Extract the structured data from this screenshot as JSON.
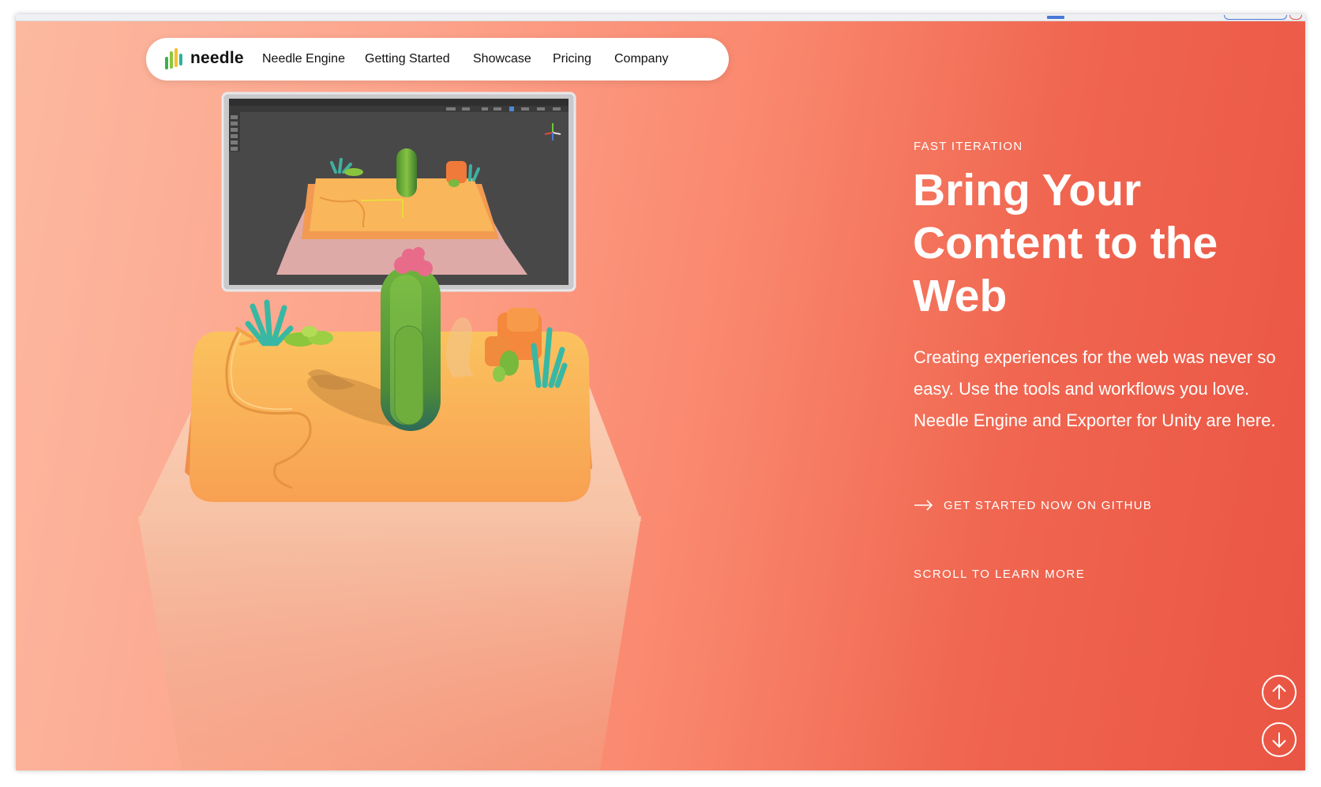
{
  "nav": {
    "logo_text": "needle",
    "items": [
      {
        "label": "Needle Engine"
      },
      {
        "label": "Getting Started"
      },
      {
        "label": "Showcase"
      },
      {
        "label": "Pricing"
      },
      {
        "label": "Company"
      }
    ]
  },
  "hero": {
    "eyebrow": "FAST ITERATION",
    "headline_lines": [
      "Bring Your",
      "Content to the",
      "Web"
    ],
    "body": "Creating experiences for the web was never so easy. Use the tools and workflows you love. Needle Engine and Exporter for Unity are here.",
    "cta_label": "GET STARTED NOW ON GITHUB",
    "scroll_hint": "SCROLL TO LEARN MORE"
  },
  "icons": {
    "cta": "arrow-right-icon",
    "scroll_up": "arrow-up-icon",
    "scroll_down": "arrow-down-icon"
  },
  "colors": {
    "bg_left": "#fcb9a0",
    "bg_right": "#ea5543",
    "text": "#ffffff",
    "nav_bg": "#ffffff",
    "sand": "#f6a95a",
    "cactus": "#78b83c"
  }
}
